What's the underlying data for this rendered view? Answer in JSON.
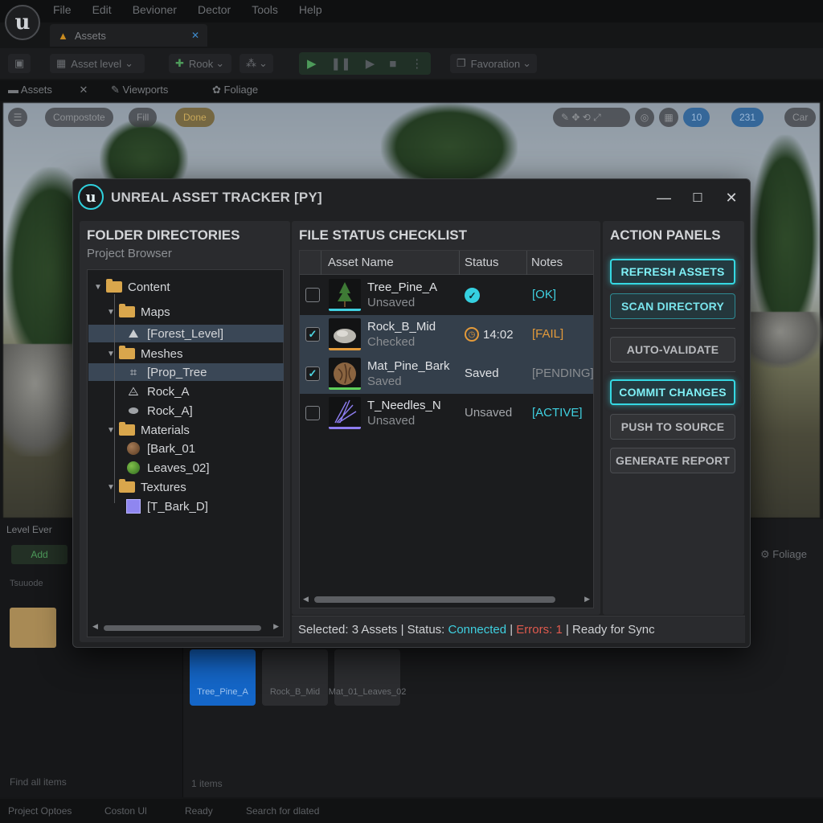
{
  "editor": {
    "menu": [
      "File",
      "Edit",
      "Bevioner",
      "Dector",
      "Tools",
      "Help"
    ],
    "doc_tab": "Assets",
    "toolbar": {
      "level": "Asset level",
      "rook": "Rook",
      "favoration": "Favoration"
    },
    "panel_tabs": [
      "Assets",
      "Viewports",
      "Foliage"
    ],
    "viewport_pills": [
      "Compostote",
      "Fill",
      "Done",
      "10",
      "231",
      "Car"
    ],
    "lower": {
      "level": "Level Ever",
      "add": "Add",
      "filter": "Tsuuode",
      "foliage": "Foliage",
      "find": "Find all items",
      "count": "1 items"
    },
    "thumbs": [
      "Tree_Pine_A",
      "Rock_B_Mid",
      "Mat_01_Leaves_02"
    ],
    "status": [
      "Project Optoes",
      "Coston Ul",
      "Ready",
      "Search for dlated"
    ]
  },
  "window": {
    "title": "UNREAL ASSET TRACKER [PY]",
    "controls": {
      "minimize": "—",
      "maximize": "☐",
      "close": "✕"
    }
  },
  "folders": {
    "title": "FOLDER DIRECTORIES",
    "subtitle": "Project Browser",
    "nodes": [
      "Content",
      "Maps",
      "[Forest_Level]",
      "Meshes",
      "[Prop_Tree",
      "Rock_A",
      "Rock_A]",
      "Materials",
      "[Bark_01",
      "Leaves_02]",
      "Textures",
      "[T_Bark_D]"
    ]
  },
  "checklist": {
    "title": "FILE STATUS CHECKLIST",
    "headers": [
      "Asset Name",
      "Status",
      "Notes"
    ],
    "rows": [
      {
        "name": "Tree_Pine_A",
        "sub": "Unsaved",
        "status": "",
        "note": "[OK]",
        "checked": false
      },
      {
        "name": "Rock_B_Mid",
        "sub": "Checked",
        "status": "14:02",
        "note": "[FAIL]",
        "checked": true
      },
      {
        "name": "Mat_Pine_Bark",
        "sub": "Saved",
        "status": "Saved",
        "note": "[PENDING]",
        "checked": true
      },
      {
        "name": "T_Needles_N",
        "sub": "Unsaved",
        "status": "Unsaved",
        "note": "[ACTIVE]",
        "checked": false
      }
    ],
    "check_mark": "✓"
  },
  "actions": {
    "title": "ACTION PANELS",
    "buttons": [
      "REFRESH ASSETS",
      "SCAN DIRECTORY",
      "AUTO-VALIDATE",
      "COMMIT CHANGES",
      "PUSH TO SOURCE",
      "GENERATE REPORT"
    ]
  },
  "statusline": {
    "selected": "Selected: 3 Assets",
    "sep": " | ",
    "status_label": "Status: ",
    "status_value": "Connected",
    "errors": "Errors: 1",
    "ready": "Ready for Sync"
  },
  "colors": {
    "accent": "#35d8e2",
    "ok": "#3fd0e0",
    "fail": "#e39a3a",
    "pending": "#8a8d91",
    "error": "#e05a4e",
    "folder": "#d9a64c"
  }
}
